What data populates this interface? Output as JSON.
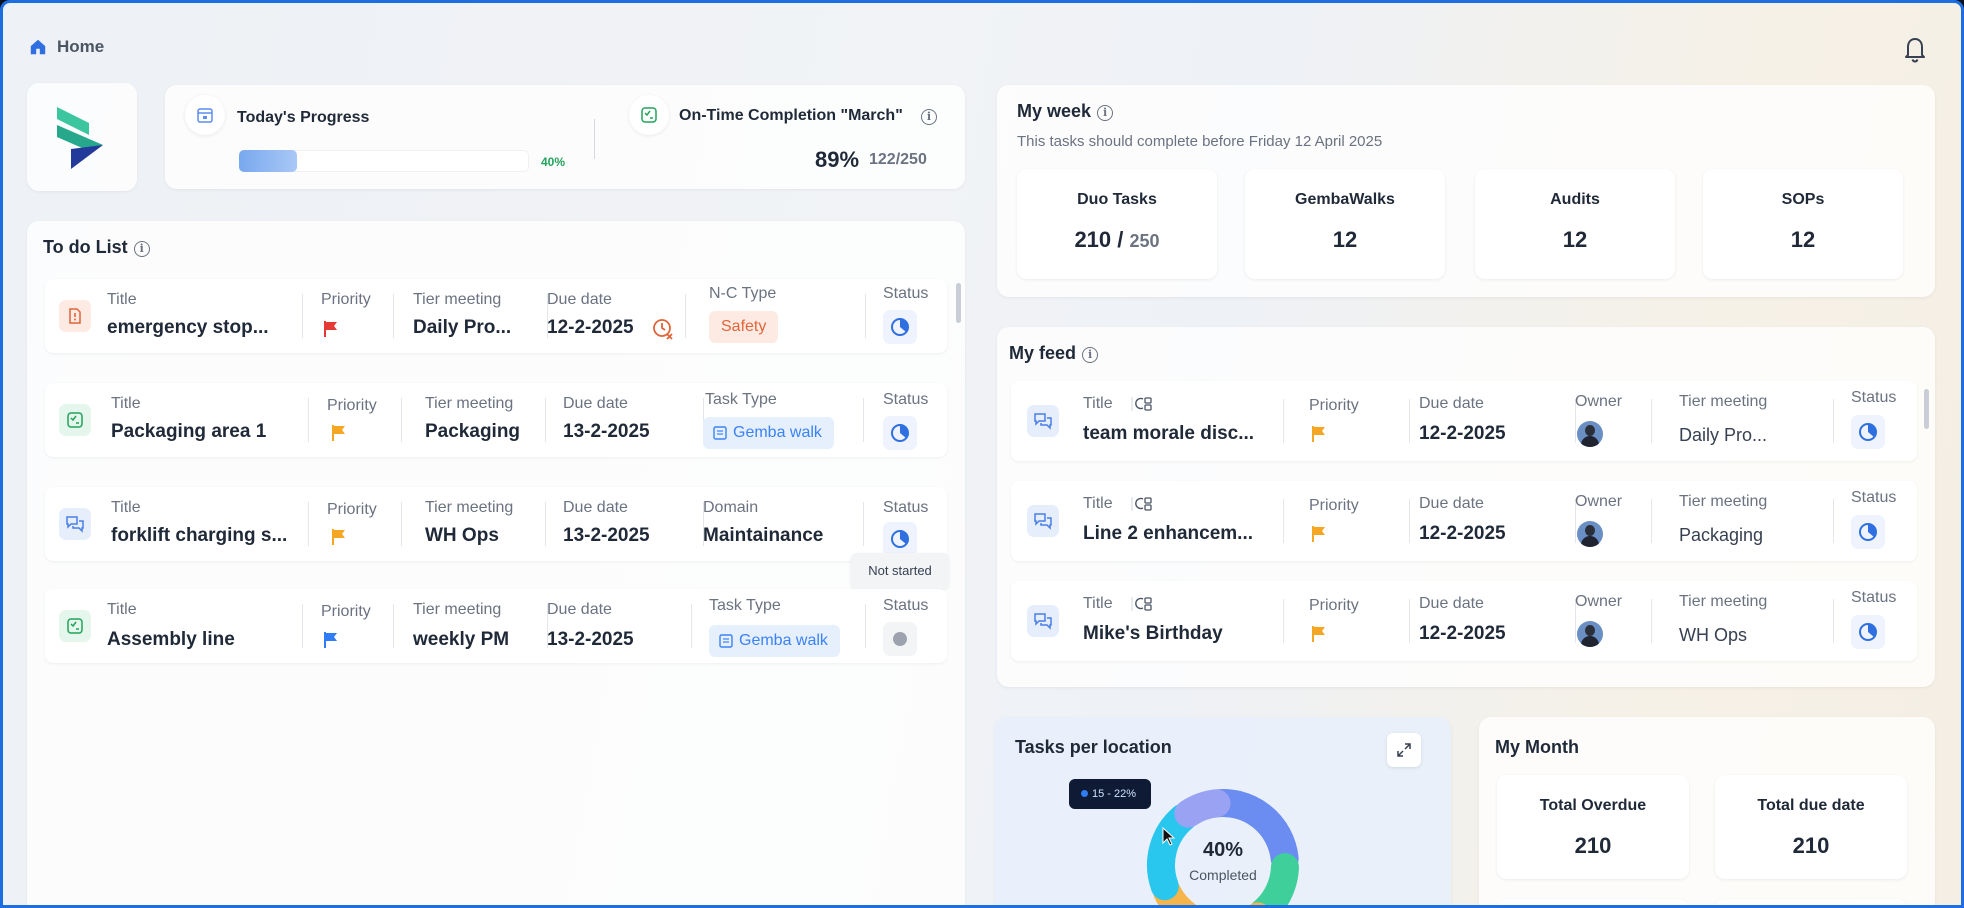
{
  "breadcrumb": {
    "home_label": "Home"
  },
  "progress": {
    "today_label": "Today's Progress",
    "today_percent_text": "40%",
    "today_fraction": 0.2,
    "completion_label": "On-Time Completion \"March\"",
    "completion_percent": "89%",
    "completion_count": "122/250"
  },
  "todo": {
    "title": "To do List",
    "tooltip": "Not started",
    "rows": [
      {
        "title_label": "Title",
        "title": "emergency stop...",
        "priority_label": "Priority",
        "tier_label": "Tier meeting",
        "tier": "Daily Pro...",
        "due_label": "Due date",
        "due": "12-2-2025",
        "extra_label": "N-C Type",
        "extra_value": "Safety",
        "status_label": "Status",
        "priority_color": "#e53935"
      },
      {
        "title_label": "Title",
        "title": "Packaging area 1",
        "priority_label": "Priority",
        "tier_label": "Tier meeting",
        "tier": "Packaging",
        "due_label": "Due date",
        "due": "13-2-2025",
        "extra_label": "Task Type",
        "extra_value": "Gemba walk",
        "status_label": "Status",
        "priority_color": "#f5a623"
      },
      {
        "title_label": "Title",
        "title": "forklift charging s...",
        "priority_label": "Priority",
        "tier_label": "Tier meeting",
        "tier": "WH Ops",
        "due_label": "Due date",
        "due": "13-2-2025",
        "extra_label": "Domain",
        "extra_value": "Maintainance",
        "status_label": "Status",
        "priority_color": "#f5a623"
      },
      {
        "title_label": "Title",
        "title": "Assembly line",
        "priority_label": "Priority",
        "tier_label": "Tier meeting",
        "tier": "weekly PM",
        "due_label": "Due date",
        "due": "13-2-2025",
        "extra_label": "Task Type",
        "extra_value": "Gemba walk",
        "status_label": "Status",
        "priority_color": "#2f7cf6"
      }
    ]
  },
  "week": {
    "title": "My week",
    "subtitle": "This tasks should complete before Friday 12 April 2025",
    "tiles": [
      {
        "label": "Duo Tasks",
        "value": "210 /",
        "total": "250"
      },
      {
        "label": "GembaWalks",
        "value": "12"
      },
      {
        "label": "Audits",
        "value": "12"
      },
      {
        "label": "SOPs",
        "value": "12"
      }
    ]
  },
  "feed": {
    "title": "My feed",
    "rows": [
      {
        "title_label": "Title",
        "title": "team morale disc...",
        "priority_label": "Priority",
        "due_label": "Due date",
        "due": "12-2-2025",
        "owner_label": "Owner",
        "tier_label": "Tier meeting",
        "tier": "Daily Pro...",
        "status_label": "Status"
      },
      {
        "title_label": "Title",
        "title": "Line 2 enhancem...",
        "priority_label": "Priority",
        "due_label": "Due date",
        "due": "12-2-2025",
        "owner_label": "Owner",
        "tier_label": "Tier meeting",
        "tier": "Packaging",
        "status_label": "Status"
      },
      {
        "title_label": "Title",
        "title": "Mike's Birthday",
        "priority_label": "Priority",
        "due_label": "Due date",
        "due": "12-2-2025",
        "owner_label": "Owner",
        "tier_label": "Tier meeting",
        "tier": "WH Ops",
        "status_label": "Status"
      }
    ]
  },
  "tasks_location": {
    "title": "Tasks per location",
    "tooltip": "15 - 22%",
    "center_value": "40%",
    "center_label": "Completed",
    "segment_colors": [
      "#6b8cf0",
      "#3fcf9b",
      "#f5b54a",
      "#29c6ee",
      "#9aa3f3"
    ]
  },
  "month": {
    "title": "My Month",
    "tiles": [
      {
        "label": "Total Overdue",
        "value": "210"
      },
      {
        "label": "Total due date",
        "value": "210"
      }
    ]
  },
  "colors": {
    "accent": "#2f7cf6",
    "success": "#22a35a",
    "safety": "#e0653a"
  },
  "icons": [
    "home-icon",
    "bell-icon",
    "info-icon",
    "calendar-icon",
    "checklist-icon",
    "flag-icon",
    "status-clock-icon",
    "overdue-clock-icon",
    "chat-icon",
    "expand-icon",
    "avatar"
  ]
}
